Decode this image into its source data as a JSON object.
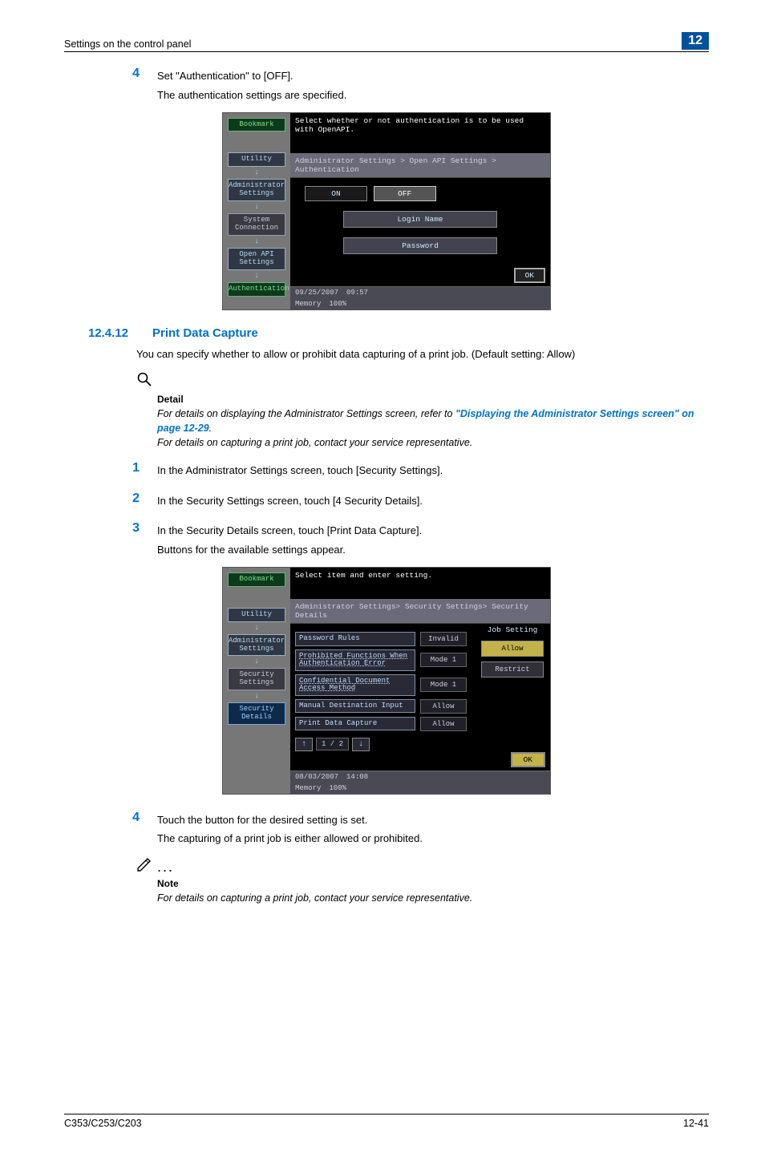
{
  "header": {
    "left": "Settings on the control panel",
    "chapter": "12"
  },
  "step4a": {
    "num": "4",
    "text": "Set \"Authentication\" to [OFF].",
    "sub": "The authentication settings are specified."
  },
  "panel1": {
    "top": "Select whether or not authentication is to be used with OpenAPI.",
    "crumb": "Administrator Settings > Open API Settings > Authentication",
    "bookmark": "Bookmark",
    "side": [
      "Utility",
      "Administrator\nSettings",
      "System\nConnection",
      "Open API\nSettings",
      "Authentication"
    ],
    "on": "ON",
    "off": "OFF",
    "login": "Login Name",
    "password": "Password",
    "ok": "OK",
    "status": {
      "date": "09/25/2007",
      "time": "09:57",
      "memlbl": "Memory",
      "mem": "100%"
    }
  },
  "section": {
    "num": "12.4.12",
    "title": "Print Data Capture",
    "intro": "You can specify whether to allow or prohibit data capturing of a print job. (Default setting: Allow)"
  },
  "detail": {
    "label": "Detail",
    "line1a": "For details on displaying the Administrator Settings screen, refer to ",
    "link": "\"Displaying the Administrator Settings screen\" on page 12-29",
    "period": ".",
    "line2": "For details on capturing a print job, contact your service representative."
  },
  "steps": {
    "s1": {
      "num": "1",
      "text": "In the Administrator Settings screen, touch [Security Settings]."
    },
    "s2": {
      "num": "2",
      "text": "In the Security Settings screen, touch [4 Security Details]."
    },
    "s3": {
      "num": "3",
      "text": "In the Security Details screen, touch [Print Data Capture].",
      "sub": "Buttons for the available settings appear."
    }
  },
  "panel2": {
    "top": "Select item and enter setting.",
    "crumb": "Administrator Settings> Security Settings> Security Details",
    "bookmark": "Bookmark",
    "side": [
      "Utility",
      "Administrator\nSettings",
      "Security\nSettings",
      "Security Details"
    ],
    "rows": [
      {
        "label": "Password Rules",
        "val": "Invalid"
      },
      {
        "label": "Prohibited Functions When Authentication Error",
        "val": "Mode 1"
      },
      {
        "label": "Confidential Document Access Method",
        "val": "Mode 1"
      },
      {
        "label": "Manual Destination Input",
        "val": "Allow"
      },
      {
        "label": "Print Data Capture",
        "val": "Allow"
      }
    ],
    "rightHead": "Job Setting",
    "allow": "Allow",
    "restrict": "Restrict",
    "page": "1 / 2",
    "ok": "OK",
    "status": {
      "date": "08/03/2007",
      "time": "14:08",
      "memlbl": "Memory",
      "mem": "100%"
    }
  },
  "step4b": {
    "num": "4",
    "text": "Touch the button for the desired setting is set.",
    "sub": "The capturing of a print job is either allowed or prohibited."
  },
  "note": {
    "label": "Note",
    "text": "For details on capturing a print job, contact your service representative."
  },
  "footer": {
    "left": "C353/C253/C203",
    "right": "12-41"
  }
}
